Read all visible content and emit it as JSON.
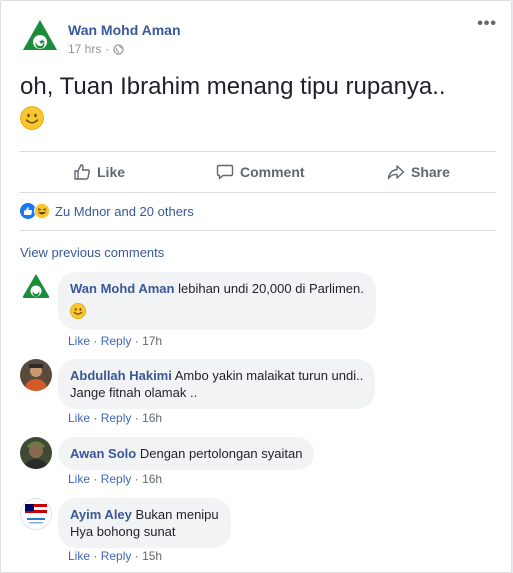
{
  "post": {
    "author": "Wan Mohd Aman",
    "time": "17 hrs",
    "separator": "·",
    "text": "oh, Tuan Ibrahim menang tipu rupanya..",
    "more_icon": "more-options-icon",
    "more_glyph": "•••"
  },
  "actions": {
    "like": "Like",
    "comment": "Comment",
    "share": "Share"
  },
  "reactions": {
    "summary": "Zu Mdnor and 20 others",
    "types": [
      "like",
      "haha"
    ]
  },
  "comments_section": {
    "view_previous": "View previous comments",
    "items": [
      {
        "name": "Wan Mohd Aman",
        "text": "lebihan undi 20,000 di Parlimen.",
        "line2": "",
        "like": "Like",
        "reply": "Reply",
        "dot": "·",
        "time": "17h"
      },
      {
        "name": "Abdullah Hakimi",
        "text": "Ambo yakin malaikat turun undi..",
        "line2": "Jange fitnah olamak ..",
        "like": "Like",
        "reply": "Reply",
        "dot": "·",
        "time": "16h"
      },
      {
        "name": "Awan Solo",
        "text": "Dengan pertolongan syaitan",
        "line2": "",
        "like": "Like",
        "reply": "Reply",
        "dot": "·",
        "time": "16h"
      },
      {
        "name": "Ayim Aley",
        "text": "Bukan menipu",
        "line2": "Hya bohong sunat",
        "like": "Like",
        "reply": "Reply",
        "dot": "·",
        "time": "15h"
      }
    ]
  },
  "colors": {
    "link": "#385898",
    "muted": "#90949c",
    "bubble": "#f2f3f5",
    "like_blue": "#1877f2",
    "emoji_yellow": "#f7c631",
    "logo_green": "#1a8c3a"
  }
}
